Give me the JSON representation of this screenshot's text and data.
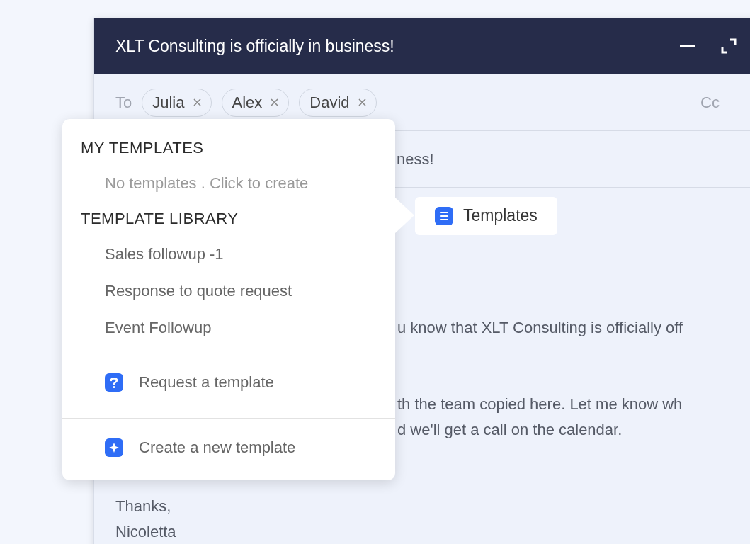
{
  "compose": {
    "title": "XLT Consulting is officially in business!",
    "to_label": "To",
    "recipients": [
      {
        "name": "Julia"
      },
      {
        "name": "Alex"
      },
      {
        "name": "David"
      }
    ],
    "cc_label": "Cc",
    "subject": "ness!",
    "templates_button": "Templates",
    "paragraphs": [
      [
        "u know that XLT Consulting is officially off"
      ],
      [
        "th the team copied here. Let me know wh",
        "d we'll get a call on the calendar."
      ]
    ],
    "signoff": [
      "Thanks,",
      "Nicoletta"
    ]
  },
  "popover": {
    "sections": [
      {
        "heading": "MY TEMPLATES",
        "items": [
          {
            "label": "No templates . Click to create",
            "kind": "empty"
          }
        ]
      },
      {
        "heading": "TEMPLATE LIBRARY",
        "items": [
          {
            "label": "Sales followup -1",
            "kind": "template"
          },
          {
            "label": "Response to quote request",
            "kind": "template"
          },
          {
            "label": "Event Followup",
            "kind": "template"
          }
        ]
      }
    ],
    "actions": [
      {
        "label": "Request a template",
        "kind": "request"
      },
      {
        "label": "Create a new template",
        "kind": "create"
      }
    ]
  }
}
